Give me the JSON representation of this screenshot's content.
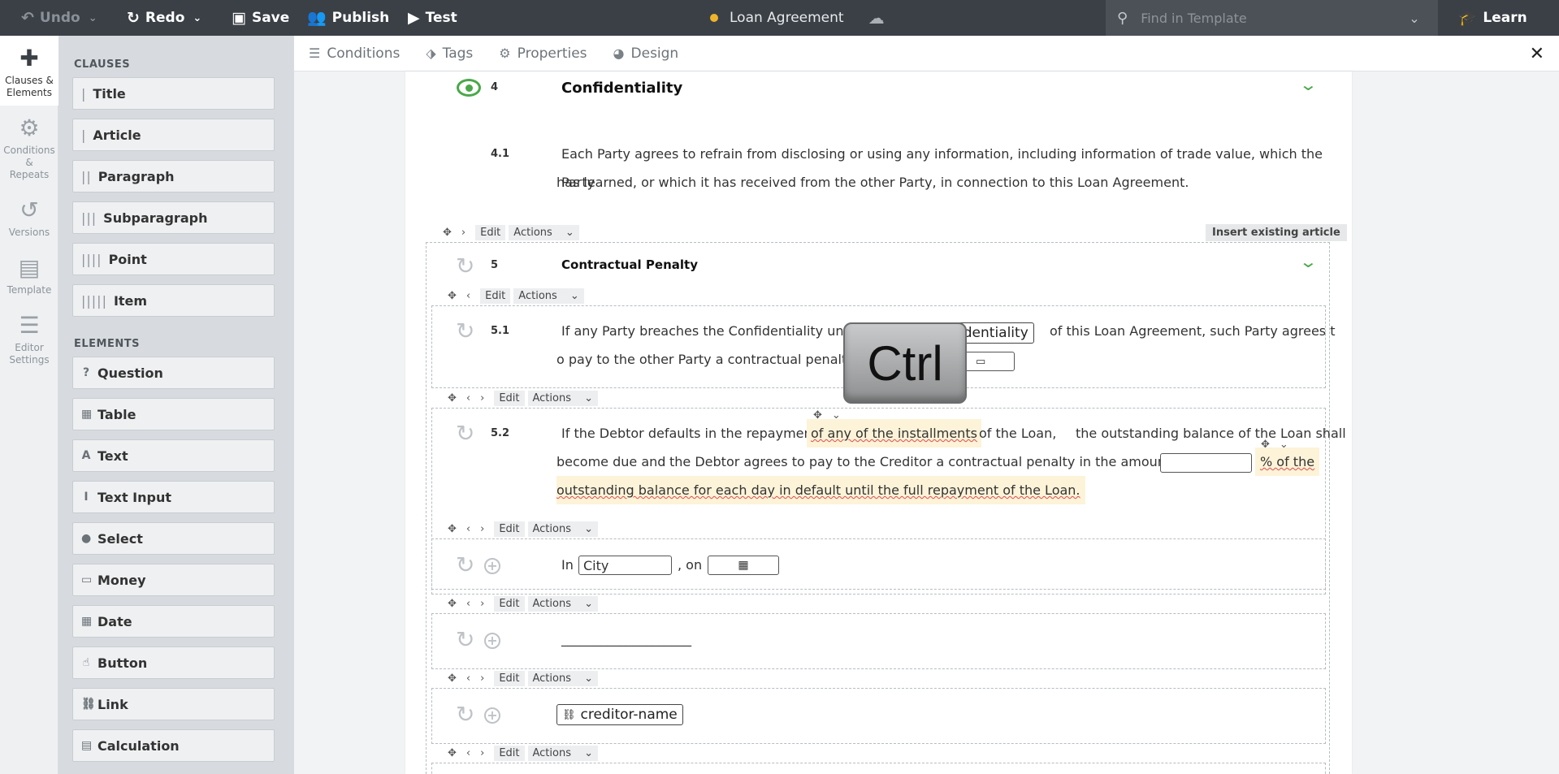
{
  "toolbar": {
    "undo": "Undo",
    "redo": "Redo",
    "save": "Save",
    "publish": "Publish",
    "test": "Test",
    "document_title": "Loan Agreement",
    "status_color": "#f0b429",
    "search_placeholder": "Find in Template",
    "learn": "Learn"
  },
  "rail": {
    "items": [
      {
        "label_1": "Clauses &",
        "label_2": "Elements",
        "icon": "puzzle-icon"
      },
      {
        "label_1": "Conditions &",
        "label_2": "Repeats",
        "icon": "gears-icon"
      },
      {
        "label_1": "Versions",
        "label_2": "",
        "icon": "history-icon"
      },
      {
        "label_1": "Template",
        "label_2": "",
        "icon": "file-icon"
      },
      {
        "label_1": "Editor",
        "label_2": "Settings",
        "icon": "sliders-icon"
      }
    ]
  },
  "panel": {
    "clauses_title": "CLAUSES",
    "clauses": [
      {
        "label": "Title",
        "bars": "|"
      },
      {
        "label": "Article",
        "bars": "|"
      },
      {
        "label": "Paragraph",
        "bars": "||"
      },
      {
        "label": "Subparagraph",
        "bars": "|||"
      },
      {
        "label": "Point",
        "bars": "||||"
      },
      {
        "label": "Item",
        "bars": "|||||"
      }
    ],
    "elements_title": "ELEMENTS",
    "elements": [
      {
        "label": "Question",
        "icon": "?"
      },
      {
        "label": "Table",
        "icon": "▦"
      },
      {
        "label": "Text",
        "icon": "A"
      },
      {
        "label": "Text Input",
        "icon": "I"
      },
      {
        "label": "Select",
        "icon": "●"
      },
      {
        "label": "Money",
        "icon": "▭"
      },
      {
        "label": "Date",
        "icon": "▦"
      },
      {
        "label": "Button",
        "icon": "☝"
      },
      {
        "label": "Link",
        "icon": "⛓"
      },
      {
        "label": "Calculation",
        "icon": "▤"
      }
    ]
  },
  "tabs": [
    "Conditions",
    "Tags",
    "Properties",
    "Design"
  ],
  "document": {
    "article4": {
      "num": "4",
      "title": "Confidentiality",
      "para_num": "4.1",
      "para_line1": "Each Party agrees to refrain from disclosing or using any information, including information of trade value, which the Party",
      "para_line2": "has learned, or which it has received from the other Party, in connection to this Loan Agreement."
    },
    "toolbar_labels": {
      "edit": "Edit",
      "actions": "Actions",
      "insert_existing": "Insert existing article"
    },
    "article5": {
      "num": "5",
      "title": "Contractual Penalty",
      "p51_num": "5.1",
      "p51_line1_a": "If any Party breaches the Confidentiality under",
      "p51_ref": "Confidentiality",
      "p51_line1_b": "of this Loan Agreement, such Party agrees t",
      "p51_line2": "o pay to the other Party a contractual penalty i",
      "p52_num": "5.2",
      "p52_line1_a": "If the Debtor defaults in the repayment",
      "p52_hl1": "of any of the installments",
      "p52_line1_b": "of the Loan,",
      "p52_line1_c": "the outstanding balance of the Loan shall",
      "p52_line2_a": "become due and",
      "p52_line2_b": "the Debtor agrees to pay to the Creditor a contractual penalty in the amount of",
      "p52_hl2": "% of the",
      "p52_line3": "outstanding balance for each day in default until the full repayment of the Loan."
    },
    "signature": {
      "in_label": "In",
      "city_placeholder": "City",
      "on_label": ", on",
      "line": "____________________",
      "creditor_ref": "creditor-name"
    }
  },
  "overlay": {
    "key": "Ctrl"
  }
}
